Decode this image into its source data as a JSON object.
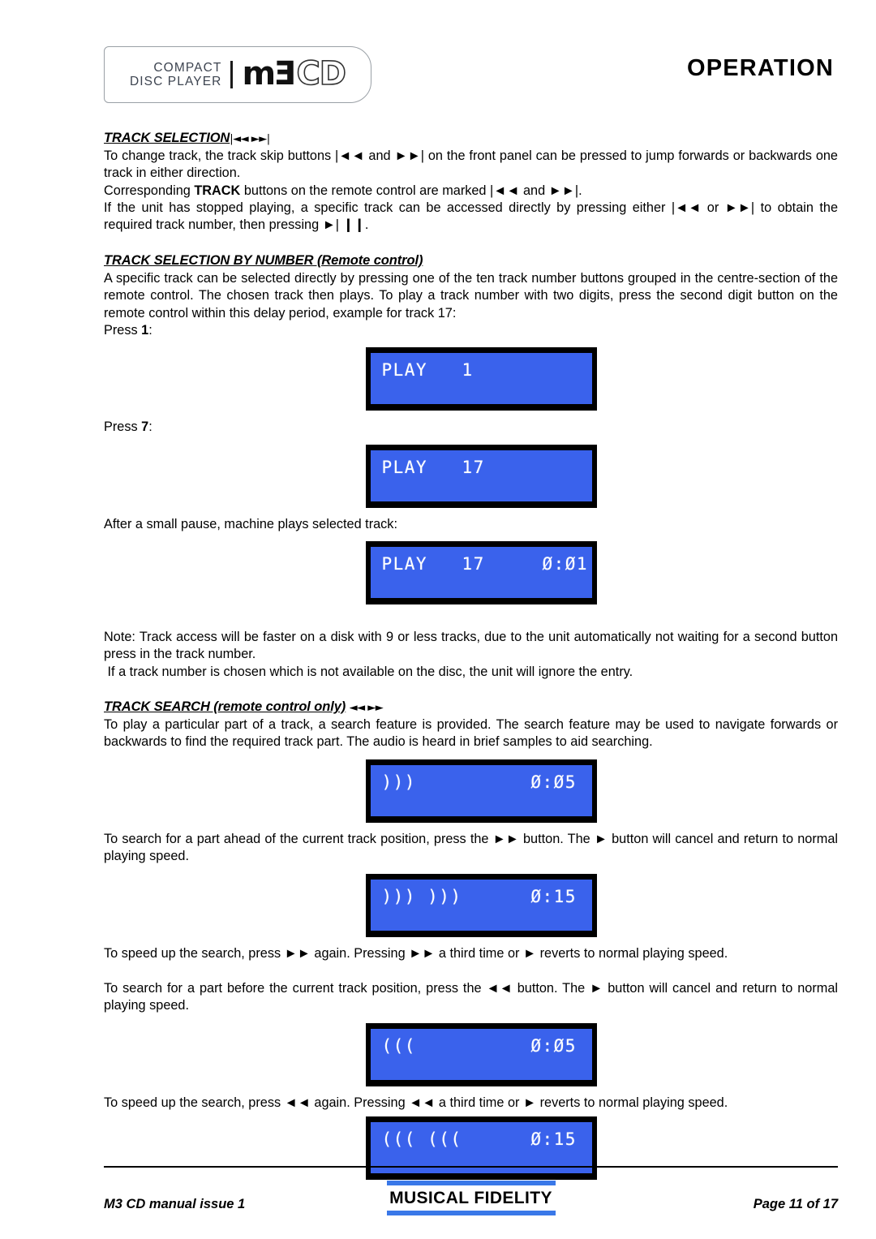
{
  "header": {
    "logo": {
      "line1": "COMPACT",
      "line2": "DISC PLAYER",
      "model_dark": "m3",
      "model_outline": "CD"
    },
    "page_title": "OPERATION"
  },
  "sections": {
    "track_selection": {
      "heading": "TRACK SELECTION",
      "heading_glyphs": "|◄◄  ►►|",
      "para1": "To change track, the track skip buttons |◄◄ and ►►| on the front panel can be pressed to jump forwards or backwards one track in either direction.",
      "para2_pre": "Corresponding ",
      "para2_bold": "TRACK",
      "para2_post": " buttons on the remote control are marked |◄◄ and ►►|.",
      "para3": "If the unit has stopped playing, a specific track can be accessed directly by pressing either |◄◄ or ►►| to obtain the required track number, then pressing ►| ❙❙."
    },
    "track_selection_by_number": {
      "heading": "TRACK SELECTION BY NUMBER (Remote control)",
      "para1": "A specific track can be selected directly by pressing one of the ten track number buttons grouped in the centre-section of the remote control.  The chosen track then plays.  To play a track number with two digits, press the second digit button on the remote control within this delay period, example for track 17:",
      "press1_pre": "Press ",
      "press1_bold": "1",
      "press1_post": ":",
      "press7_pre": "Press ",
      "press7_bold": "7",
      "press7_post": ":",
      "after_pause": "After a small pause, machine plays selected track:",
      "note": "Note: Track access will be faster on a disk with 9 or less tracks, due to the unit automatically not waiting for a second button press in the track number.",
      "note2": "If a track number is chosen which is not available on the disc, the unit will ignore the entry."
    },
    "track_search": {
      "heading": "TRACK SEARCH (remote control only)",
      "heading_glyphs": "◄◄  ►►",
      "para1": "To play a particular part of a track, a search feature is provided. The search feature may be used to navigate forwards or backwards to find the required track part. The audio is heard in brief samples to aid searching.",
      "para2": "To search for a part ahead of the current track position, press the ►► button. The ► button will cancel and return to normal playing speed.",
      "para3": "To speed up the search, press ►► again. Pressing ►► a third time or ► reverts to normal playing speed.",
      "para4": "To search for a part before the current track position, press the ◄◄ button. The ► button will cancel and return to normal playing speed.",
      "para5": "To speed up the search, press ◄◄ again. Pressing ◄◄ a third time or ► reverts to normal playing speed."
    }
  },
  "displays": [
    {
      "id": "play-track-1",
      "text": "PLAY   1"
    },
    {
      "id": "play-track-17",
      "text": "PLAY   17"
    },
    {
      "id": "play-track-17-time",
      "text": "PLAY   17     Ø:Ø1"
    },
    {
      "id": "search-fwd-1x",
      "text": ")))          Ø:Ø5"
    },
    {
      "id": "search-fwd-2x",
      "text": "))) )))      Ø:15"
    },
    {
      "id": "search-rev-1x",
      "text": "(((          Ø:Ø5"
    },
    {
      "id": "search-rev-2x",
      "text": "((( (((      Ø:15"
    }
  ],
  "footer": {
    "left": "M3 CD manual issue 1",
    "brand": "MUSICAL FIDELITY",
    "right": "Page 11 of 17",
    "accent_color": "#3a78e8"
  },
  "colors": {
    "lcd_blue": "#3a62ec",
    "lcd_text": "#ffffff",
    "lcd_bezel": "#000000"
  }
}
